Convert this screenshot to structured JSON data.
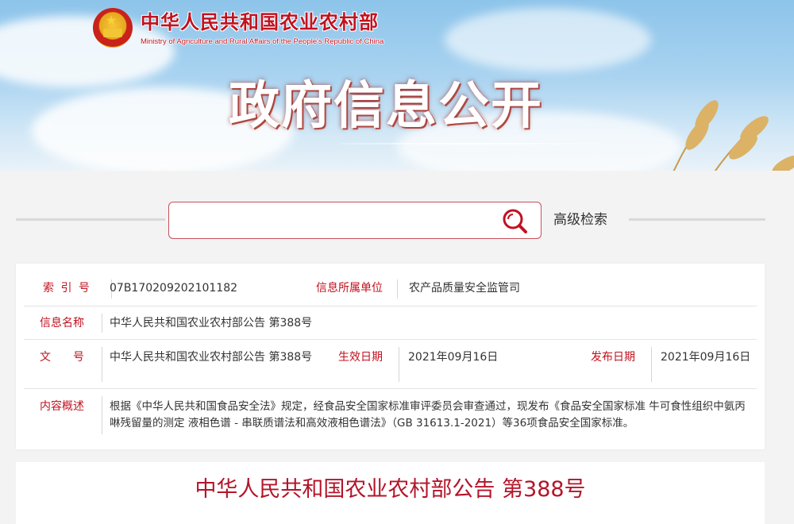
{
  "header": {
    "ministry_name_cn": "中华人民共和国农业农村部",
    "ministry_name_en": "Ministry of Agriculture and Rural Affairs of the People's Republic of China",
    "section_title": "政府信息公开",
    "emblem_icon": "national-emblem-icon"
  },
  "search": {
    "value": "",
    "placeholder": "",
    "icon": "search-icon",
    "advanced_label": "高级检索"
  },
  "info": {
    "index_label": "索 引 号",
    "index_value": "07B170209202101182",
    "org_label": "信息所属单位",
    "org_value": "农产品质量安全监管司",
    "name_label": "信息名称",
    "name_value": "中华人民共和国农业农村部公告 第388号",
    "doc_label": "文　　号",
    "doc_value": "中华人民共和国农业农村部公告 第388号",
    "effective_label": "生效日期",
    "effective_value": "2021年09月16日",
    "publish_label": "发布日期",
    "publish_value": "2021年09月16日",
    "summary_label": "内容概述",
    "summary_value": "根据《中华人民共和国食品安全法》规定，经食品安全国家标准审评委员会审查通过，现发布《食品安全国家标准 牛可食性组织中氨丙啉残留量的测定 液相色谱 - 串联质谱法和高效液相色谱法》（GB 31613.1-2021）等36项食品安全国家标准。"
  },
  "article": {
    "title": "中华人民共和国农业农村部公告 第388号"
  },
  "colors": {
    "accent_red": "#c1121f",
    "title_red": "#b3152a",
    "search_border": "#c9505b",
    "page_bg": "#f3f3f3"
  }
}
